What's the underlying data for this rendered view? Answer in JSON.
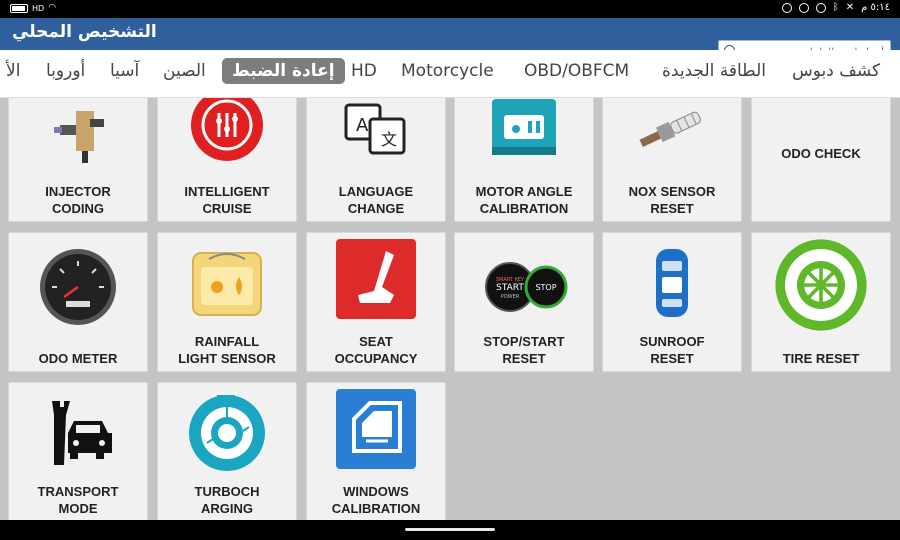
{
  "status": {
    "battery_label": "HD",
    "time": "٥:١٤ م"
  },
  "app": {
    "title": "التشخيص المحلي",
    "search_placeholder": "أدخل اسم الطراز"
  },
  "tabs": [
    {
      "label": "كشف دبوس",
      "active": false
    },
    {
      "label": "الطاقة الجديدة",
      "active": false
    },
    {
      "label": "OBD/OBFCM",
      "active": false
    },
    {
      "label": "Motorcycle",
      "active": false
    },
    {
      "label": "HD",
      "active": false
    },
    {
      "label": "إعادة الضبط",
      "active": true
    },
    {
      "label": "الصين",
      "active": false
    },
    {
      "label": "آسيا",
      "active": false
    },
    {
      "label": "أوروبا",
      "active": false
    },
    {
      "label": "الأ",
      "active": false
    }
  ],
  "tiles": [
    {
      "label": "INJECTOR\nCODING",
      "icon": "injector-icon"
    },
    {
      "label": "INTELLIGENT\nCRUISE",
      "icon": "cruise-control-icon"
    },
    {
      "label": "LANGUAGE\nCHANGE",
      "icon": "language-translate-icon"
    },
    {
      "label": "MOTOR ANGLE\nCALIBRATION",
      "icon": "motor-icon"
    },
    {
      "label": "NOX SENSOR\nRESET",
      "icon": "nox-sensor-icon"
    },
    {
      "label": "ODO CHECK",
      "icon": ""
    },
    {
      "label": "ODO METER",
      "icon": "speedometer-icon"
    },
    {
      "label": "RAINFALL\nLIGHT SENSOR",
      "icon": "rain-light-sensor-icon"
    },
    {
      "label": "SEAT\nOCCUPANCY",
      "icon": "seat-icon"
    },
    {
      "label": "STOP/START\nRESET",
      "icon": "stop-start-icon"
    },
    {
      "label": "SUNROOF\nRESET",
      "icon": "sunroof-car-icon"
    },
    {
      "label": "TIRE RESET",
      "icon": "tire-icon"
    },
    {
      "label": "TRANSPORT\nMODE",
      "icon": "transport-mode-icon"
    },
    {
      "label": "TURBOCH\nARGING",
      "icon": "turbo-icon"
    },
    {
      "label": "WINDOWS\nCALIBRATION",
      "icon": "window-icon"
    }
  ],
  "stopstart_icon_text": {
    "left_small": "SMART KEY",
    "left_big": "START",
    "left_sub": "POWER",
    "right": "STOP"
  },
  "colors": {
    "titlebar": "#2f5f9c",
    "active_tab": "#7d7d7d",
    "grid_background": "#c4c4c4",
    "tile_background": "#f1f1f1"
  }
}
